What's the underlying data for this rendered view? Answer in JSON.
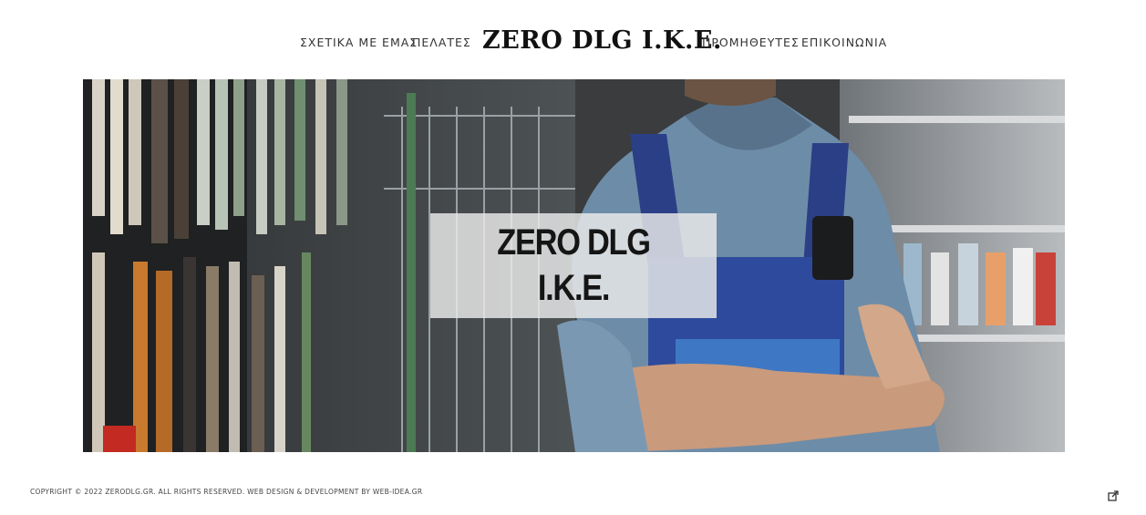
{
  "nav": {
    "items": [
      {
        "label": "ΣΧΕΤΙΚΑ ΜΕ ΕΜΑΣ"
      },
      {
        "label": "ΠΕΛΑΤΕΣ"
      },
      {
        "label": "ΠΡΟΜΗΘΕΥΤΕΣ"
      },
      {
        "label": "ΕΠΙΚΟΙΝΩΝΙΑ"
      }
    ],
    "logo": "ZERO DLG I.K.E."
  },
  "hero": {
    "line1": "ZERO DLG",
    "line2": "I.K.E.",
    "image": "worker-in-hardware-store-photo"
  },
  "footer": {
    "copyright": "COPYRIGHT © 2022 ZERODLG.GR. ALL RIGHTS RESERVED. WEB DESIGN & DEVELOPMENT BY WEB-IDEA.GR",
    "icon": "share-icon"
  }
}
